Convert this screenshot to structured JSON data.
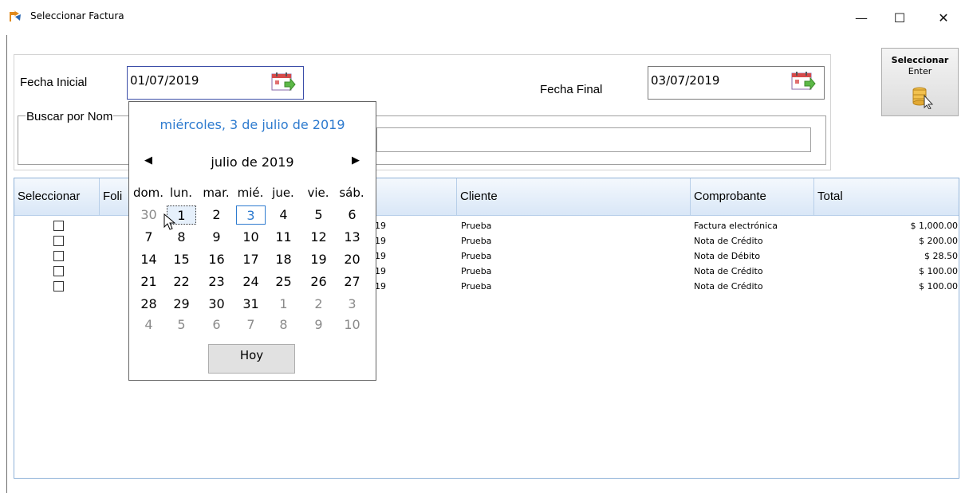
{
  "window": {
    "title": "Seleccionar Factura",
    "minimize": "—",
    "maximize": "☐",
    "close": "✕"
  },
  "filters": {
    "fecha_inicial_label": "Fecha Inicial",
    "fecha_inicial_value": "01/07/2019",
    "fecha_final_label": "Fecha Final",
    "fecha_final_value": "03/07/2019",
    "buscar_label": "Buscar por Nom",
    "buscar_value": ""
  },
  "select_button": {
    "line1": "Seleccionar",
    "line2": "Enter",
    "icon": "database-cursor-icon"
  },
  "calendar": {
    "today_header": "miércoles, 3 de julio de 2019",
    "month_label": "julio de 2019",
    "prev": "◀",
    "next": "▶",
    "days_of_week": [
      "dom.",
      "lun.",
      "mar.",
      "mié.",
      "jue.",
      "vie.",
      "sáb."
    ],
    "weeks": [
      [
        "30",
        "1",
        "2",
        "3",
        "4",
        "5",
        "6"
      ],
      [
        "7",
        "8",
        "9",
        "10",
        "11",
        "12",
        "13"
      ],
      [
        "14",
        "15",
        "16",
        "17",
        "18",
        "19",
        "20"
      ],
      [
        "21",
        "22",
        "23",
        "24",
        "25",
        "26",
        "27"
      ],
      [
        "28",
        "29",
        "30",
        "31",
        "1",
        "2",
        "3"
      ],
      [
        "4",
        "5",
        "6",
        "7",
        "8",
        "9",
        "10"
      ]
    ],
    "today_button": "Hoy"
  },
  "grid": {
    "headers": [
      "Seleccionar",
      "Foli",
      "",
      "Cliente",
      "Comprobante",
      "Total"
    ],
    "rows": [
      {
        "fecha": "19",
        "cliente": "Prueba",
        "comprobante": "Factura electrónica",
        "total": "$ 1,000.00"
      },
      {
        "fecha": "19",
        "cliente": "Prueba",
        "comprobante": "Nota de Crédito",
        "total": "$ 200.00"
      },
      {
        "fecha": "19",
        "cliente": "Prueba",
        "comprobante": "Nota de Débito",
        "total": "$ 28.50"
      },
      {
        "fecha": "19",
        "cliente": "Prueba",
        "comprobante": "Nota de Crédito",
        "total": "$ 100.00"
      },
      {
        "fecha": "19",
        "cliente": "Prueba",
        "comprobante": "Nota de Crédito",
        "total": "$ 100.00"
      }
    ]
  },
  "colors": {
    "accent": "#2e7bcf",
    "grid_header_top": "#f4f8fd",
    "grid_header_bottom": "#d9e7f7"
  }
}
